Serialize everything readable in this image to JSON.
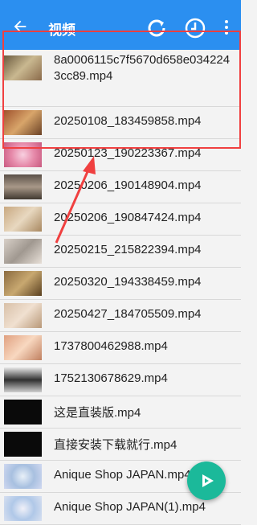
{
  "header": {
    "title": "视频",
    "back_icon": "arrow-left-icon",
    "sync_icon": "refresh-icon",
    "history_icon": "clock-icon",
    "more_icon": "more-vertical-icon"
  },
  "files": [
    {
      "name": "8a0006115c7f5670d658e0342243cc89.mp4"
    },
    {
      "name": "20250108_183459858.mp4"
    },
    {
      "name": "20250123_190223367.mp4"
    },
    {
      "name": "20250206_190148904.mp4"
    },
    {
      "name": "20250206_190847424.mp4"
    },
    {
      "name": "20250215_215822394.mp4"
    },
    {
      "name": "20250320_194338459.mp4"
    },
    {
      "name": "20250427_184705509.mp4"
    },
    {
      "name": "1737800462988.mp4"
    },
    {
      "name": "1752130678629.mp4"
    },
    {
      "name": "这是直装版.mp4"
    },
    {
      "name": "直接安装下载就行.mp4"
    },
    {
      "name": "Anique Shop JAPAN.mp4"
    },
    {
      "name": "Anique Shop JAPAN(1).mp4"
    }
  ],
  "fab": {
    "icon": "play-icon"
  },
  "colors": {
    "toolbar": "#2b8ff0",
    "highlight": "#f04040",
    "fab": "#1bb99a"
  }
}
